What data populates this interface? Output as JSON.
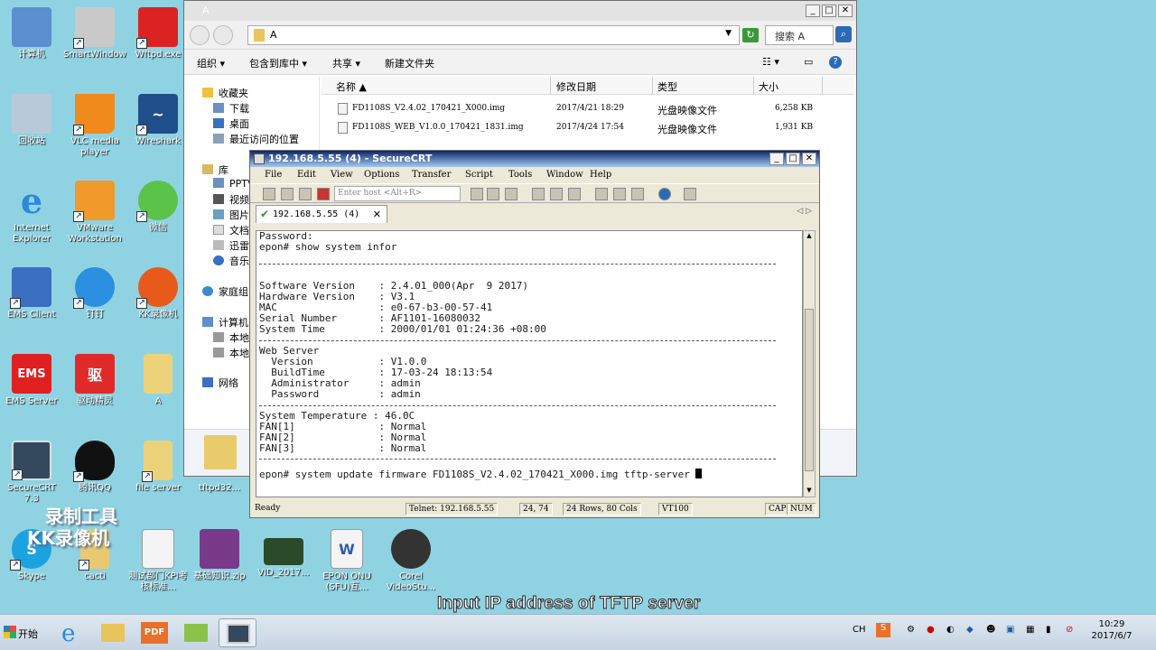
{
  "desktop": {
    "icons": [
      {
        "name": "computer",
        "label": "计算机"
      },
      {
        "name": "smartwindow",
        "label": "SmartWindow"
      },
      {
        "name": "wftpd",
        "label": "Wftpd.exe"
      },
      {
        "name": "recycle-bin",
        "label": "回收站"
      },
      {
        "name": "vlc",
        "label": "VLC media player"
      },
      {
        "name": "wireshark",
        "label": "Wireshark"
      },
      {
        "name": "ie",
        "label": "Internet Explorer"
      },
      {
        "name": "vmware",
        "label": "VMware Workstation"
      },
      {
        "name": "wechat",
        "label": "微信"
      },
      {
        "name": "ems-client",
        "label": "EMS Client"
      },
      {
        "name": "dingding",
        "label": "钉钉"
      },
      {
        "name": "kk-recorder",
        "label": "KK录像机"
      },
      {
        "name": "ems-server",
        "label": "EMS Server"
      },
      {
        "name": "driver-genius",
        "label": "驱动精灵"
      },
      {
        "name": "folder-a",
        "label": "A"
      },
      {
        "name": "securecrt",
        "label": "SecureCRT 7.3"
      },
      {
        "name": "qq",
        "label": "腾讯QQ"
      },
      {
        "name": "file-server",
        "label": "file server"
      },
      {
        "name": "tftpd32",
        "label": "tftpd32..."
      },
      {
        "name": "skype",
        "label": "Skype"
      },
      {
        "name": "cacti",
        "label": "cacti"
      },
      {
        "name": "kpi-doc",
        "label": "测试部门KPI考核标准..."
      },
      {
        "name": "basics-zip",
        "label": "基础知识.zip"
      },
      {
        "name": "vid",
        "label": "VID_2017..."
      },
      {
        "name": "epon-onu",
        "label": "EPON ONU (SFU)互..."
      },
      {
        "name": "corel",
        "label": "Corel VideoStu..."
      }
    ]
  },
  "explorer": {
    "title": "A",
    "address": "A",
    "search_placeholder": "搜索 A",
    "toolbar": {
      "organize": "组织",
      "include": "包含到库中",
      "share": "共享",
      "new_folder": "新建文件夹"
    },
    "nav": {
      "favorites": "收藏夹",
      "downloads": "下载",
      "desktop": "桌面",
      "recent": "最近访问的位置",
      "libraries": "库",
      "pptv": "PPTV",
      "videos": "视频",
      "pictures": "图片",
      "docs": "文档",
      "xunlei": "迅雷",
      "music": "音乐",
      "homegroup": "家庭组",
      "computer": "计算机",
      "local1": "本地",
      "local2": "本地",
      "network": "网络"
    },
    "columns": {
      "name": "名称",
      "date": "修改日期",
      "type": "类型",
      "size": "大小"
    },
    "files": [
      {
        "name": "FD1108S_V2.4.02_170421_X000.img",
        "date": "2017/4/21 18:29",
        "type": "光盘映像文件",
        "size": "6,258 KB"
      },
      {
        "name": "FD1108S_WEB_V1.0.0_170421_1831.img",
        "date": "2017/4/24 17:54",
        "type": "光盘映像文件",
        "size": "1,931 KB"
      }
    ]
  },
  "crt": {
    "title": "192.168.5.55 (4) - SecureCRT",
    "menu": [
      "File",
      "Edit",
      "View",
      "Options",
      "Transfer",
      "Script",
      "Tools",
      "Window",
      "Help"
    ],
    "host_placeholder": "Enter host <Alt+R>",
    "tab_label": "192.168.5.55 (4)",
    "terminal": {
      "block1": "Password:\nepon# show system infor",
      "block2": "\nSoftware Version    : 2.4.01_000(Apr  9 2017)\nHardware Version    : V3.1\nMAC                 : e0-67-b3-00-57-41\nSerial Number       : AF1101-16080032\nSystem Time         : 2000/01/01 01:24:36 +08:00",
      "block3": "Web Server\n  Version           : V1.0.0\n  BuildTime         : 17-03-24 18:13:54\n  Administrator     : admin\n  Password          : admin",
      "block4": "System Temperature : 46.0C\nFAN[1]              : Normal\nFAN[2]              : Normal\nFAN[3]              : Normal",
      "command": "epon# system update firmware FD1108S_V2.4.02_170421_X000.img tftp-server "
    },
    "status": {
      "ready": "Ready",
      "telnet": "Telnet: 192.168.5.55",
      "pos": "24,  74",
      "size": "24 Rows, 80 Cols",
      "term": "VT100",
      "cap": "CAP",
      "num": "NUM"
    }
  },
  "overlay": {
    "subtitle": "Input IP address of  TFTP server",
    "watermark_line1": "录制工具",
    "watermark_line2": "KK录像机"
  },
  "taskbar": {
    "start": "开始",
    "ime": "CH",
    "time": "10:29",
    "date": "2017/6/7"
  }
}
